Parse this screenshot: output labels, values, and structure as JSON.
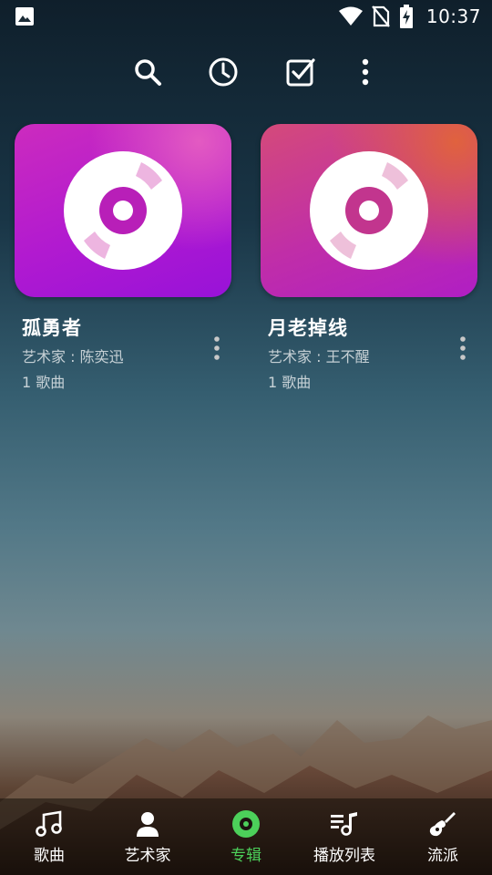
{
  "status_bar": {
    "time": "10:37"
  },
  "toolbar": {
    "icons": [
      "search-icon",
      "history-icon",
      "select-icon",
      "more-vert-icon"
    ]
  },
  "albums": [
    {
      "title": "孤勇者",
      "artist": "艺术家 : 陈奕迅",
      "song_count": "1 歌曲",
      "cover_colors": [
        "#c729c0",
        "#a712d8"
      ]
    },
    {
      "title": "月老掉线",
      "artist": "艺术家 : 王不醒",
      "song_count": "1 歌曲",
      "cover_colors": [
        "#d84a6a",
        "#b21fc0"
      ]
    }
  ],
  "bottom_nav": {
    "items": [
      {
        "label": "歌曲",
        "icon": "music-note-icon"
      },
      {
        "label": "艺术家",
        "icon": "person-icon"
      },
      {
        "label": "专辑",
        "icon": "album-icon",
        "active": true
      },
      {
        "label": "播放列表",
        "icon": "playlist-icon"
      },
      {
        "label": "流派",
        "icon": "guitar-icon"
      }
    ],
    "active_color": "#4cd05a"
  }
}
